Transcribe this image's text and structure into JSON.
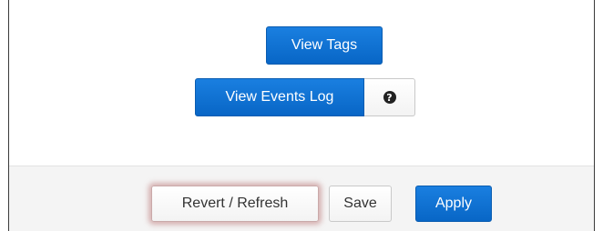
{
  "content": {
    "view_tags_label": "View Tags",
    "view_events_log_label": "View Events Log",
    "help_icon_glyph": "?"
  },
  "footer": {
    "revert_label": "Revert / Refresh",
    "save_label": "Save",
    "apply_label": "Apply"
  },
  "colors": {
    "primary": "#0b6fd3",
    "footer_bg": "#f4f4f4",
    "focus_glow": "#be7878"
  }
}
